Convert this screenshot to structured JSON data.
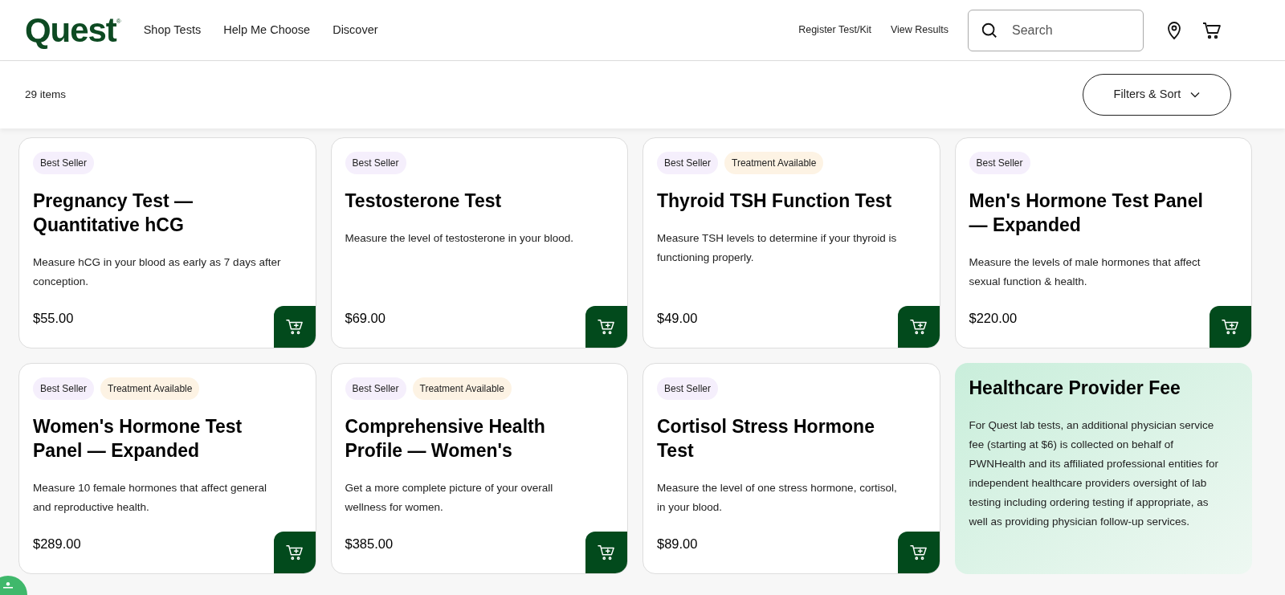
{
  "header": {
    "logo": "Quest",
    "logo_mark": "®",
    "nav": [
      "Shop Tests",
      "Help Me Choose",
      "Discover"
    ],
    "links": [
      "Register Test/Kit",
      "View Results"
    ],
    "search": {
      "placeholder": "Search"
    }
  },
  "toolbar": {
    "count": "29 items",
    "filter_button": "Filters & Sort"
  },
  "cards": [
    {
      "kind": "product",
      "badges": [
        {
          "kind": "best_seller",
          "label": "Best Seller"
        }
      ],
      "title": "Pregnancy Test — Quantitative hCG",
      "description": "Measure hCG in your blood as early as 7 days after conception.",
      "price": "$55.00"
    },
    {
      "kind": "product",
      "badges": [
        {
          "kind": "best_seller",
          "label": "Best Seller"
        }
      ],
      "title": "Testosterone Test",
      "description": "Measure the level of testosterone in your blood.",
      "price": "$69.00"
    },
    {
      "kind": "product",
      "badges": [
        {
          "kind": "best_seller",
          "label": "Best Seller"
        },
        {
          "kind": "treatment",
          "label": "Treatment Available"
        }
      ],
      "title": "Thyroid TSH Function Test",
      "description": "Measure TSH levels to determine if your thyroid is functioning properly.",
      "price": "$49.00"
    },
    {
      "kind": "product",
      "badges": [
        {
          "kind": "best_seller",
          "label": "Best Seller"
        }
      ],
      "title": "Men's Hormone Test Panel — Expanded",
      "description": "Measure the levels of male hormones that affect sexual function & health.",
      "price": "$220.00"
    },
    {
      "kind": "product",
      "badges": [
        {
          "kind": "best_seller",
          "label": "Best Seller"
        },
        {
          "kind": "treatment",
          "label": "Treatment Available"
        }
      ],
      "title": "Women's Hormone Test Panel — Expanded",
      "description": "Measure 10 female hormones that affect general and reproductive health.",
      "price": "$289.00"
    },
    {
      "kind": "product",
      "badges": [
        {
          "kind": "best_seller",
          "label": "Best Seller"
        },
        {
          "kind": "treatment",
          "label": "Treatment Available"
        }
      ],
      "title": "Comprehensive Health Profile — Women's",
      "description": "Get a more complete picture of your overall wellness for women.",
      "price": "$385.00"
    },
    {
      "kind": "product",
      "badges": [
        {
          "kind": "best_seller",
          "label": "Best Seller"
        }
      ],
      "title": "Cortisol Stress Hormone Test",
      "description": "Measure the level of one stress hormone, cortisol, in your blood.",
      "price": "$89.00"
    },
    {
      "kind": "info",
      "title": "Healthcare Provider Fee",
      "description": "For Quest lab tests, an additional physician service fee (starting at $6) is collected on behalf of PWNHealth and its affiliated professional entities for independent healthcare providers oversight of lab testing including ordering testing if appropriate, as well as providing physician follow-up services."
    }
  ]
}
